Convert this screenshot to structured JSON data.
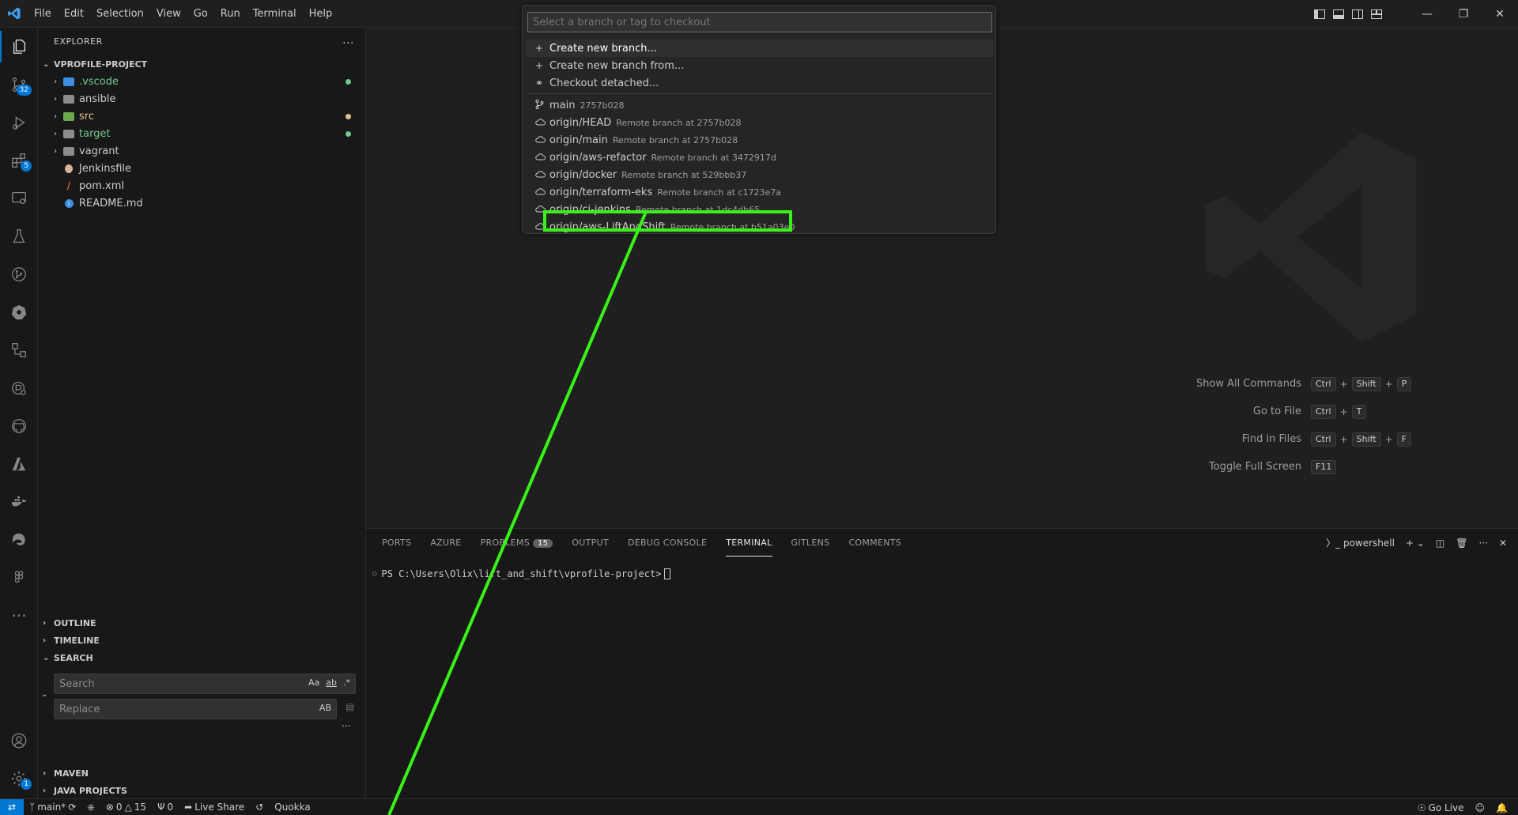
{
  "menu": [
    "File",
    "Edit",
    "Selection",
    "View",
    "Go",
    "Run",
    "Terminal",
    "Help"
  ],
  "activity_badges": {
    "scm": "32",
    "extensions": "5",
    "settings": "1"
  },
  "explorer": {
    "header": "EXPLORER",
    "more": "...",
    "project": "VPROFILE-PROJECT",
    "items": [
      {
        "name": ".vscode",
        "type": "folder",
        "color": "#73c991",
        "dot": "#73c991"
      },
      {
        "name": "ansible",
        "type": "folder",
        "color": "#cccccc",
        "dot": ""
      },
      {
        "name": "src",
        "type": "folder",
        "color": "#e2c08d",
        "dot": "#e2c08d"
      },
      {
        "name": "target",
        "type": "folder",
        "color": "#73c991",
        "dot": "#73c991"
      },
      {
        "name": "vagrant",
        "type": "folder",
        "color": "#cccccc",
        "dot": ""
      },
      {
        "name": "Jenkinsfile",
        "type": "file",
        "color": "#cccccc",
        "dot": ""
      },
      {
        "name": "pom.xml",
        "type": "file",
        "color": "#cccccc",
        "dot": ""
      },
      {
        "name": "README.md",
        "type": "file",
        "color": "#cccccc",
        "dot": ""
      }
    ],
    "sections": {
      "outline": "OUTLINE",
      "timeline": "TIMELINE",
      "search": "SEARCH",
      "maven": "MAVEN",
      "java_projects": "JAVA PROJECTS"
    }
  },
  "search": {
    "placeholder": "Search",
    "replace_placeholder": "Replace",
    "opt_case": "Aa",
    "opt_word": "ab",
    "opt_regex": ".*",
    "opt_preserve": "AB",
    "more": "..."
  },
  "quickpick": {
    "placeholder": "Select a branch or tag to checkout",
    "actions": [
      {
        "label": "Create new branch..."
      },
      {
        "label": "Create new branch from..."
      },
      {
        "label": "Checkout detached..."
      }
    ],
    "branches": [
      {
        "label": "main",
        "desc": "2757b028",
        "icon": "branch"
      },
      {
        "label": "origin/HEAD",
        "desc": "Remote branch at 2757b028",
        "icon": "cloud"
      },
      {
        "label": "origin/main",
        "desc": "Remote branch at 2757b028",
        "icon": "cloud"
      },
      {
        "label": "origin/aws-refactor",
        "desc": "Remote branch at 3472917d",
        "icon": "cloud"
      },
      {
        "label": "origin/docker",
        "desc": "Remote branch at 529bbb37",
        "icon": "cloud"
      },
      {
        "label": "origin/terraform-eks",
        "desc": "Remote branch at c1723e7a",
        "icon": "cloud"
      },
      {
        "label": "origin/ci-jenkins",
        "desc": "Remote branch at 1dc4db65",
        "icon": "cloud"
      },
      {
        "label": "origin/aws-LiftAndShift",
        "desc": "Remote branch at b51a03e0",
        "icon": "cloud"
      }
    ]
  },
  "shortcuts": [
    {
      "label": "Show All Commands",
      "keys": [
        "Ctrl",
        "Shift",
        "P"
      ]
    },
    {
      "label": "Go to File",
      "keys": [
        "Ctrl",
        "T"
      ]
    },
    {
      "label": "Find in Files",
      "keys": [
        "Ctrl",
        "Shift",
        "F"
      ]
    },
    {
      "label": "Toggle Full Screen",
      "keys": [
        "F11"
      ]
    }
  ],
  "panel": {
    "tabs": [
      "PORTS",
      "AZURE",
      "PROBLEMS",
      "OUTPUT",
      "DEBUG CONSOLE",
      "TERMINAL",
      "GITLENS",
      "COMMENTS"
    ],
    "problems_count": "15",
    "active_tab": "TERMINAL",
    "shell": "powershell",
    "prompt": "PS C:\\Users\\Olix\\lift_and_shift\\vprofile-project>"
  },
  "status": {
    "branch": "main*",
    "errors": "0",
    "warnings": "15",
    "ports": "0",
    "live_share": "Live Share",
    "quokka": "Quokka",
    "go_live": "Go Live"
  },
  "colors": {
    "accent": "#0078d4",
    "highlight": "#39f21a"
  }
}
